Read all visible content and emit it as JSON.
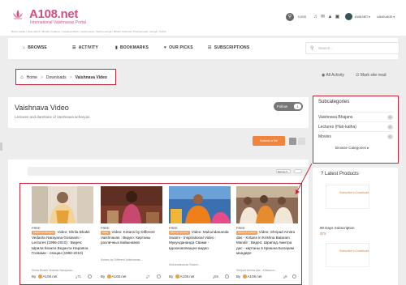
{
  "brand": {
    "title": "A108.net",
    "subtitle": "International Vaishnavas Portal",
    "links": "Rathi-rasika | Gita-vahini | Bhakti-Vedanta | Gaudiya-Math | Vaishnavas | Sadhu-sanga | Bhakti Shiksha | Prabhupada | Sanga | Katha"
  },
  "topbar": {
    "cart_label": "0.00 $",
    "user_label": "A108.NET ▾",
    "lang_label": "LANGUAGE ▾"
  },
  "nav": {
    "items": [
      {
        "icon": "⌂",
        "label": "BROWSE"
      },
      {
        "icon": "☰",
        "label": "ACTIVITY"
      },
      {
        "icon": "▮",
        "label": "BOOKMARKS"
      },
      {
        "icon": "♥",
        "label": "OUR PICKS"
      },
      {
        "icon": "☷",
        "label": "SUBSCRIPTIONS"
      }
    ],
    "search_placeholder": "Search..."
  },
  "breadcrumb": {
    "home": "Home",
    "sep": ">",
    "downloads": "Downloads",
    "current": "Vaishnava Video"
  },
  "actions": {
    "all_activity": "All Activity",
    "mark_read": "Mark site read"
  },
  "category": {
    "title": "Vaishnava Video",
    "description": "Lectures and darshans of Vaishnava acharyas.",
    "follow_label": "Follow",
    "follow_count": "1"
  },
  "toolbar": {
    "submit_label": "Submit a file",
    "sort_label": "Sort by ▾"
  },
  "videos": [
    {
      "price": "FREE",
      "badge": "Vaishnava Bhajans",
      "text": "Video: Shrila Bhakti Vedanta Narayana Goswami - Lectures (1996-2010) : Видео: Шрила Бхакти Веданта Нараяна Госвами - лекции (1996-2010)",
      "author_line": "Shrila Bhakti Vedanta Narayana...",
      "by": "By",
      "uploader": "A108.net",
      "downloads": "71"
    },
    {
      "price": "FREE",
      "badge": "Other",
      "text": "Video: Kirtans by Different Vaishnavas : Видео: Киртаны различных вайшнавов",
      "author_line": "Kirtans by Different Vaishnavas...",
      "by": "By",
      "uploader": "A108.net",
      "downloads": "7"
    },
    {
      "price": "FREE",
      "badge": "Kirtans Lectures",
      "text": "Video: Mukundananda Swami - Inspirational Video : Мукундананда Свами - вдохновляющее видео",
      "author_line": "Mukundananda Swami...",
      "by": "By",
      "uploader": "A108.net",
      "downloads": "56"
    },
    {
      "price": "FREE",
      "badge": "Kirtans Lectures",
      "text": "Video: Shripad Amitra das - Kirtans in Krishna Balaram Mandir : Видео: Шрипад Амитра дас - киртаны в Кришна Баларам мандире",
      "author_line": "Shripad Amitra das - Kirtans in...",
      "by": "By",
      "uploader": "A108.net",
      "downloads": "8"
    }
  ],
  "subcategories": {
    "title": "Subcategories",
    "items": [
      {
        "label": "Vaishnava Bhajans",
        "count": "0"
      },
      {
        "label": "Lectures (Hari-katha)",
        "count": "0"
      },
      {
        "label": "Movies",
        "count": "0"
      }
    ],
    "browse_label": "Browse Categories ▸"
  },
  "latest": {
    "title": "Latest Products",
    "promo_text": "Subscribe to Download",
    "product_name": "90 Days Subscription",
    "product_price": "$75"
  },
  "colors": {
    "brand": "#d14f86",
    "highlight": "#c8283c",
    "accent": "#f0843c"
  }
}
